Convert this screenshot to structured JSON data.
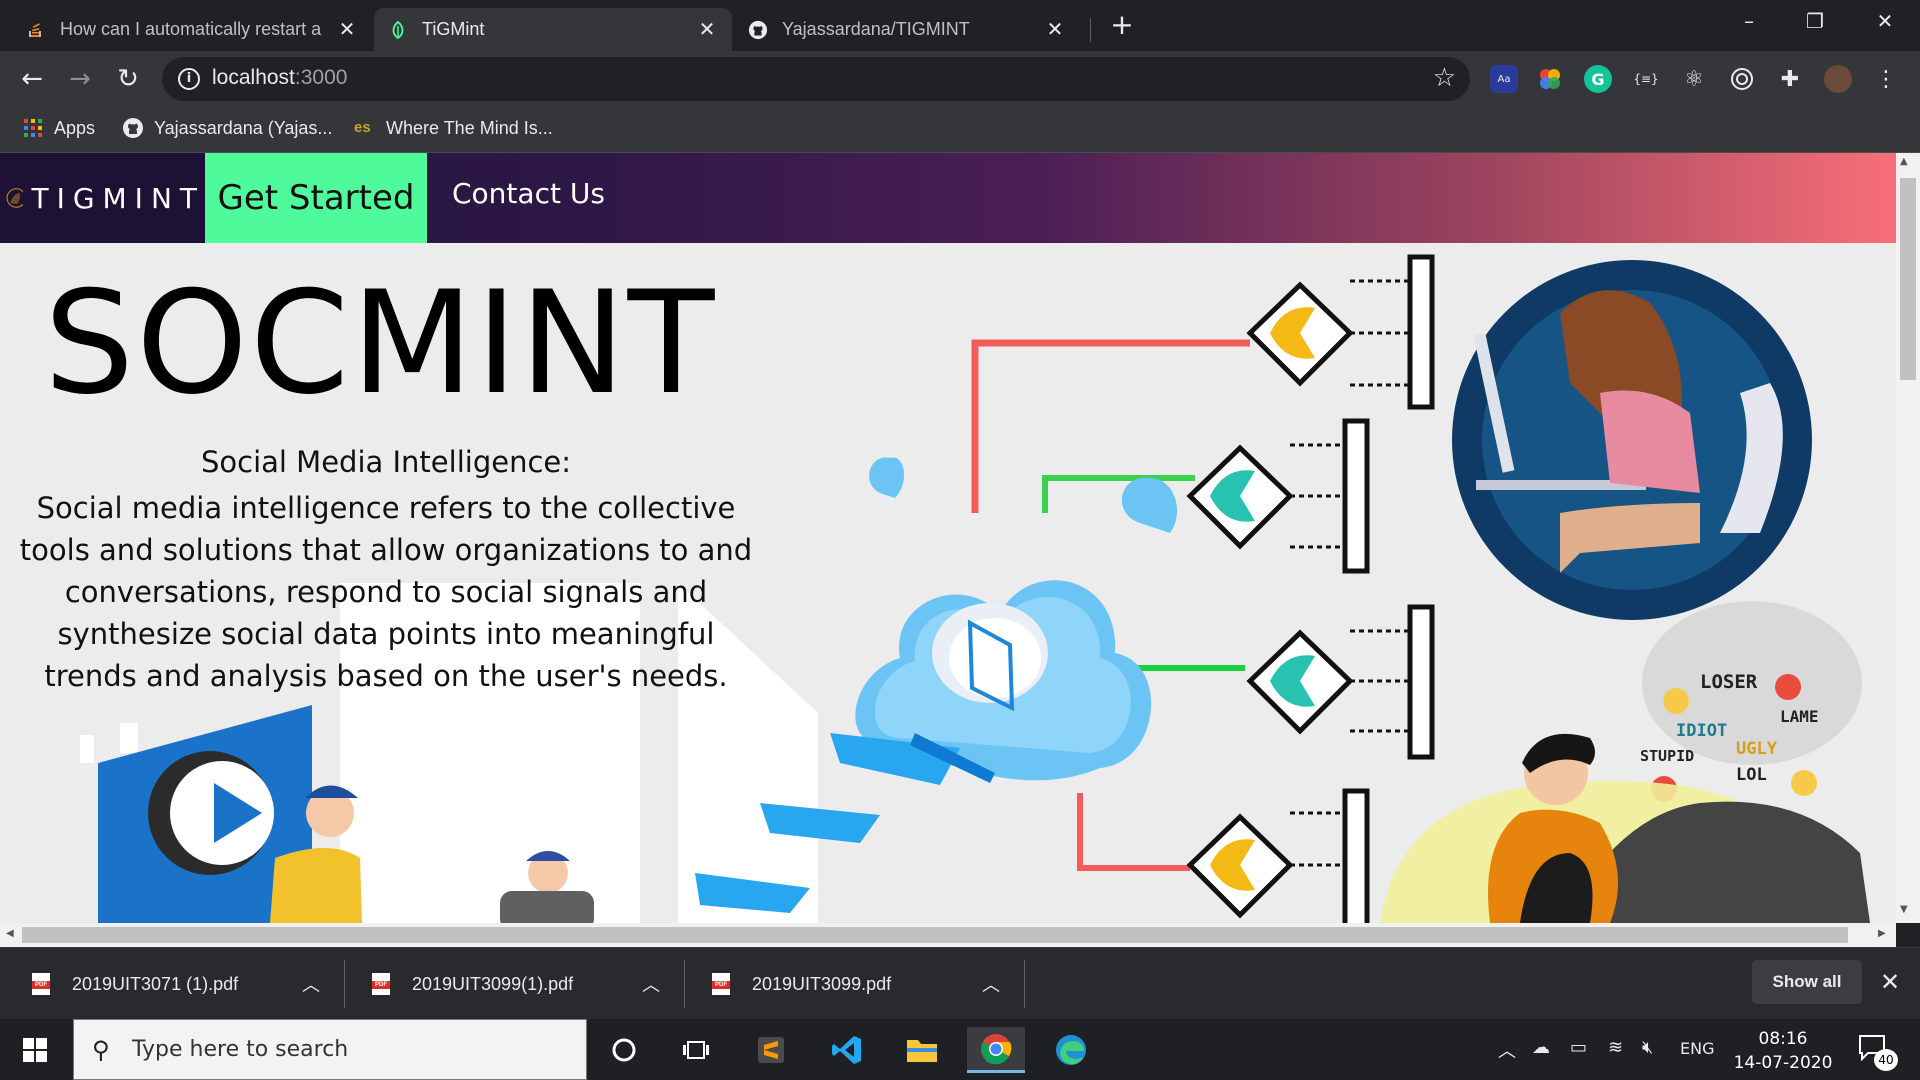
{
  "browser": {
    "tabs": [
      {
        "title": "How can I automatically restart a",
        "favicon": "stackoverflow-icon",
        "active": false
      },
      {
        "title": "TiGMint",
        "favicon": "leaf-icon",
        "active": true
      },
      {
        "title": "Yajassardana/TIGMINT",
        "favicon": "github-icon",
        "active": false
      }
    ],
    "address": {
      "host": "localhost",
      "port": ":3000"
    },
    "bookmarks": [
      {
        "label": "Apps",
        "icon": "apps-grid-icon"
      },
      {
        "label": "Yajassardana (Yajas...",
        "icon": "github-icon"
      },
      {
        "label": "Where The Mind Is...",
        "icon": "es-icon"
      }
    ]
  },
  "page": {
    "brand": "TIGMINT",
    "nav": {
      "get_started": "Get Started",
      "contact": "Contact Us"
    },
    "hero": {
      "title": "SOCMINT",
      "subtitle": "Social Media Intelligence:",
      "description": "Social media intelligence refers to the collective tools and solutions that allow organizations to and conversations, respond to social signals and synthesize social data points into meaningful trends and analysis based on the user's needs."
    },
    "illustration": {
      "speech_words": [
        "LOSER",
        "LAME",
        "IDIOT",
        "UGLY",
        "STUPID",
        "LOL"
      ]
    }
  },
  "downloads": {
    "items": [
      {
        "name": "2019UIT3071 (1).pdf"
      },
      {
        "name": "2019UIT3099(1).pdf"
      },
      {
        "name": "2019UIT3099.pdf"
      }
    ],
    "show_all": "Show all"
  },
  "taskbar": {
    "search_placeholder": "Type here to search",
    "language": "ENG",
    "time": "08:16",
    "date": "14-07-2020",
    "notification_count": "40"
  },
  "colors": {
    "accent_green": "#4efa9a",
    "nav_gradient_start": "#241641",
    "nav_gradient_end": "#f86f78"
  }
}
